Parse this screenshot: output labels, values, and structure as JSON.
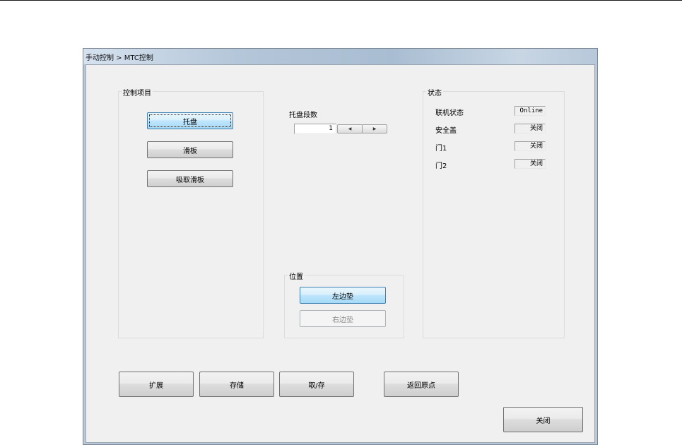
{
  "window": {
    "title": "手动控制 > MTC控制"
  },
  "control_group": {
    "title": "控制项目",
    "buttons": [
      "托盘",
      "滑板",
      "吸取滑板"
    ]
  },
  "pallet": {
    "label": "托盘段数",
    "value": "1",
    "left_arrow": "◀",
    "right_arrow": "▶"
  },
  "position_group": {
    "title": "位置",
    "left_button": "左边垫",
    "right_button": "右边垫"
  },
  "status_group": {
    "title": "状态",
    "rows": [
      {
        "label": "联机状态",
        "value": "Online"
      },
      {
        "label": "安全盖",
        "value": "关闭"
      },
      {
        "label": "门1",
        "value": "关闭"
      },
      {
        "label": "门2",
        "value": "关闭"
      }
    ]
  },
  "bottom_buttons": [
    "扩展",
    "存储",
    "取/存",
    "返回原点"
  ],
  "close_button": "关闭"
}
